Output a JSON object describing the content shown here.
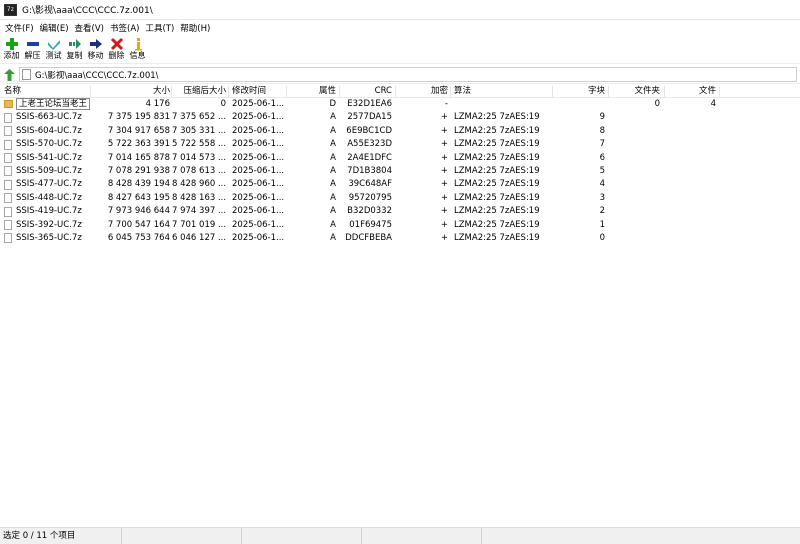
{
  "window": {
    "title": "G:\\影视\\aaa\\CCC\\CCC.7z.001\\",
    "app_icon_text": "7z"
  },
  "menu": [
    "文件(F)",
    "编辑(E)",
    "查看(V)",
    "书签(A)",
    "工具(T)",
    "帮助(H)"
  ],
  "toolbar": {
    "add_label": "添加",
    "extract_label": "解压",
    "test_label": "测试",
    "copy_label": "复制",
    "move_label": "移动",
    "delete_label": "删除",
    "info_label": "信息",
    "colors": {
      "add": "#1aa31a",
      "extract": "#1b3f9c",
      "test": "#2aa6b8",
      "copy": "#2a8a6a",
      "move": "#1b2f7a",
      "delete": "#d01818",
      "info": "#e0b000"
    }
  },
  "address": {
    "path": "G:\\影视\\aaa\\CCC\\CCC.7z.001\\"
  },
  "columns": {
    "name": "名称",
    "size": "大小",
    "packed": "压缩后大小",
    "modified": "修改时间",
    "attr": "属性",
    "crc": "CRC",
    "encrypted": "加密",
    "method": "算法",
    "block": "字块",
    "folders": "文件夹",
    "files": "文件"
  },
  "rows": [
    {
      "type": "folder",
      "name": "上老王论坛当老王",
      "size": "4 176",
      "packed": "0",
      "modified": "2025-06-1...",
      "attr": "D",
      "crc": "E32D1EA6",
      "encrypted": "-",
      "method": "",
      "block": "",
      "folders": "0",
      "files": "4"
    },
    {
      "type": "file",
      "name": "SSIS-663-UC.7z",
      "size": "7 375 195 831",
      "packed": "7 375 652 ...",
      "modified": "2025-06-1...",
      "attr": "A",
      "crc": "2577DA15",
      "encrypted": "+",
      "method": "LZMA2:25 7zAES:19",
      "block": "9",
      "folders": "",
      "files": ""
    },
    {
      "type": "file",
      "name": "SSIS-604-UC.7z",
      "size": "7 304 917 658",
      "packed": "7 305 331 ...",
      "modified": "2025-06-1...",
      "attr": "A",
      "crc": "6E9BC1CD",
      "encrypted": "+",
      "method": "LZMA2:25 7zAES:19",
      "block": "8",
      "folders": "",
      "files": ""
    },
    {
      "type": "file",
      "name": "SSIS-570-UC.7z",
      "size": "5 722 363 391",
      "packed": "5 722 558 ...",
      "modified": "2025-06-1...",
      "attr": "A",
      "crc": "A55E323D",
      "encrypted": "+",
      "method": "LZMA2:25 7zAES:19",
      "block": "7",
      "folders": "",
      "files": ""
    },
    {
      "type": "file",
      "name": "SSIS-541-UC.7z",
      "size": "7 014 165 878",
      "packed": "7 014 573 ...",
      "modified": "2025-06-1...",
      "attr": "A",
      "crc": "2A4E1DFC",
      "encrypted": "+",
      "method": "LZMA2:25 7zAES:19",
      "block": "6",
      "folders": "",
      "files": ""
    },
    {
      "type": "file",
      "name": "SSIS-509-UC.7z",
      "size": "7 078 291 938",
      "packed": "7 078 613 ...",
      "modified": "2025-06-1...",
      "attr": "A",
      "crc": "7D1B3804",
      "encrypted": "+",
      "method": "LZMA2:25 7zAES:19",
      "block": "5",
      "folders": "",
      "files": ""
    },
    {
      "type": "file",
      "name": "SSIS-477-UC.7z",
      "size": "8 428 439 194",
      "packed": "8 428 960 ...",
      "modified": "2025-06-1...",
      "attr": "A",
      "crc": "39C648AF",
      "encrypted": "+",
      "method": "LZMA2:25 7zAES:19",
      "block": "4",
      "folders": "",
      "files": ""
    },
    {
      "type": "file",
      "name": "SSIS-448-UC.7z",
      "size": "8 427 643 195",
      "packed": "8 428 163 ...",
      "modified": "2025-06-1...",
      "attr": "A",
      "crc": "95720795",
      "encrypted": "+",
      "method": "LZMA2:25 7zAES:19",
      "block": "3",
      "folders": "",
      "files": ""
    },
    {
      "type": "file",
      "name": "SSIS-419-UC.7z",
      "size": "7 973 946 644",
      "packed": "7 974 397 ...",
      "modified": "2025-06-1...",
      "attr": "A",
      "crc": "B32D0332",
      "encrypted": "+",
      "method": "LZMA2:25 7zAES:19",
      "block": "2",
      "folders": "",
      "files": ""
    },
    {
      "type": "file",
      "name": "SSIS-392-UC.7z",
      "size": "7 700 547 164",
      "packed": "7 701 019 ...",
      "modified": "2025-06-1...",
      "attr": "A",
      "crc": "01F69475",
      "encrypted": "+",
      "method": "LZMA2:25 7zAES:19",
      "block": "1",
      "folders": "",
      "files": ""
    },
    {
      "type": "file",
      "name": "SSIS-365-UC.7z",
      "size": "6 045 753 764",
      "packed": "6 046 127 ...",
      "modified": "2025-06-1...",
      "attr": "A",
      "crc": "DDCFBEBA",
      "encrypted": "+",
      "method": "LZMA2:25 7zAES:19",
      "block": "0",
      "folders": "",
      "files": ""
    }
  ],
  "status": {
    "selection": "选定 0 / 11 个项目",
    "seg2": "",
    "seg3": "",
    "seg4": ""
  }
}
